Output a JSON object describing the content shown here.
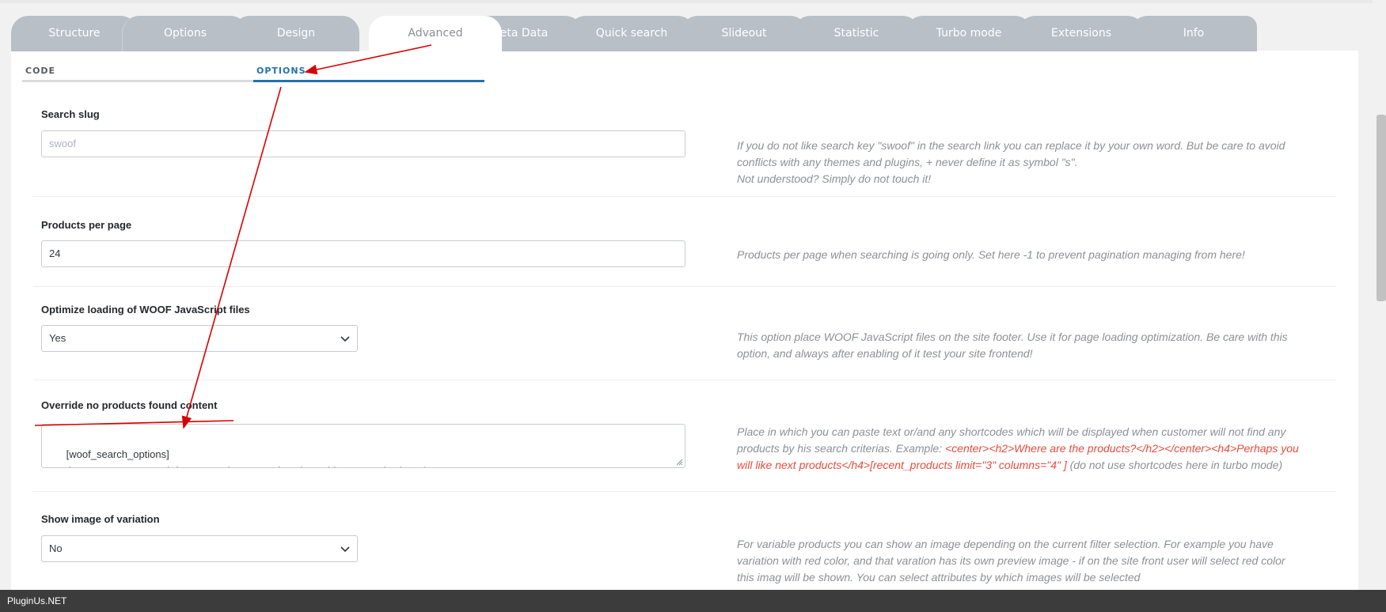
{
  "tabs": [
    {
      "label": "Structure"
    },
    {
      "label": "Options"
    },
    {
      "label": "Design"
    },
    {
      "label": "Advanced",
      "active": true
    },
    {
      "label": "Meta Data"
    },
    {
      "label": "Quick search"
    },
    {
      "label": "Slideout"
    },
    {
      "label": "Statistic"
    },
    {
      "label": "Turbo mode"
    },
    {
      "label": "Extensions"
    },
    {
      "label": "Info"
    }
  ],
  "subtabs": {
    "code": "CODE",
    "options": "OPTIONS"
  },
  "settings": {
    "search_slug": {
      "label": "Search slug",
      "placeholder": "swoof",
      "desc_1": "If you do not like search key \"swoof\" in the search link you can replace it by your own word. But be care to avoid",
      "desc_2": "conflicts with any themes and plugins, + never define it as symbol \"s\".",
      "desc_3": "Not understood? Simply do not touch it!"
    },
    "products_per_page": {
      "label": "Products per page",
      "value": "24",
      "desc": "Products per page when searching is going only. Set here -1 to prevent pagination managing from here!"
    },
    "optimize_js": {
      "label": "Optimize loading of WOOF JavaScript files",
      "value": "Yes",
      "desc_1": "This option place WOOF JavaScript files on the site footer. Use it for page loading optimization. Be care with this",
      "desc_2": "option, and always after enabling of it test your site frontend!"
    },
    "override_no_products": {
      "label": "Override no products found content",
      "value": "[woof_search_options]\n<p class=\"woocommerce-info\">No products were found matching your selection.</p>",
      "desc_1": "Place in which you can paste text or/and any shortcodes which will be displayed when customer will not find any",
      "desc_2a": "products by his search criterias. Example: ",
      "desc_2b": "<center><h2>Where are the products?</h2></center><h4>Perhaps you",
      "desc_3a": "will like next products</h4>[recent_products limit=\"3\" columns=\"4\" ]",
      "desc_3b": " (do not use shortcodes here in turbo mode)"
    },
    "show_variation_image": {
      "label": "Show image of variation",
      "value": "No",
      "desc_1": "For variable products you can show an image depending on the current filter selection. For example you have",
      "desc_2": "variation with red color, and that varation has its own preview image - if on the site front user will select red color",
      "desc_3": "this imag will be shown. You can select attributes by which images will be selected"
    }
  },
  "footer": {
    "text": "PluginUs.NET"
  },
  "colors": {
    "tab_bg": "#b9bfc6",
    "active_subtab": "#2271b1",
    "annotation": "#d90000",
    "example_red": "#e74c3c"
  }
}
